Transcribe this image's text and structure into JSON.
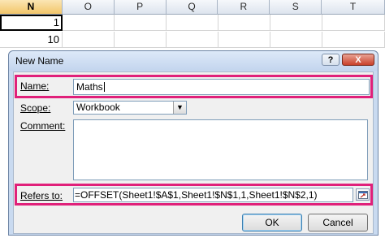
{
  "spreadsheet": {
    "columns": [
      "N",
      "O",
      "P",
      "Q",
      "R",
      "S",
      "T"
    ],
    "active_column": "N",
    "cells": {
      "N1": "1",
      "N2": "10"
    }
  },
  "dialog": {
    "title": "New Name",
    "help_label": "?",
    "close_label": "X",
    "name_label": "Name:",
    "name_value": "Maths",
    "scope_label": "Scope:",
    "scope_value": "Workbook",
    "comment_label": "Comment:",
    "comment_value": "",
    "refers_label": "Refers to:",
    "refers_value": "=OFFSET(Sheet1!$A$1,Sheet1!$N$1,1,Sheet1!$N$2,1)",
    "ok_label": "OK",
    "cancel_label": "Cancel"
  },
  "colors": {
    "highlight": "#e0207a",
    "dialog_frame": "#c9daf0",
    "panel": "#f0f0f0"
  },
  "icons": {
    "help": "help-icon",
    "close": "close-icon",
    "dropdown": "chevron-down-icon",
    "collapse": "range-select-icon"
  }
}
